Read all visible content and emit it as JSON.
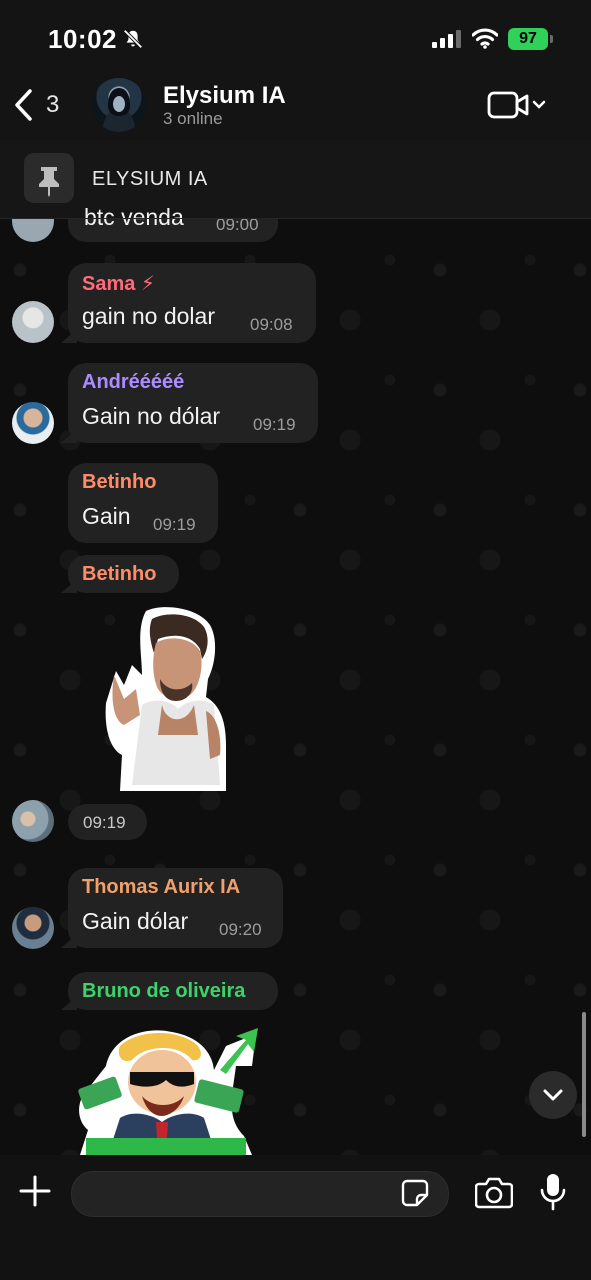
{
  "status_bar": {
    "time": "10:02",
    "battery": "97"
  },
  "header": {
    "back_count": "3",
    "group_name": "Elysium IA",
    "group_status": "3 online"
  },
  "pinned": {
    "text": "ELYSIUM IA"
  },
  "messages": [
    {
      "sender": "",
      "text": "btc venda",
      "time": "09:00"
    },
    {
      "sender": "Sama ⚡",
      "sender_color": "#ff6b7a",
      "text": "gain no dolar",
      "time": "09:08"
    },
    {
      "sender": "Andrééééé",
      "sender_color": "#a98cff",
      "text": "Gain no dólar",
      "time": "09:19"
    },
    {
      "sender": "Betinho",
      "sender_color": "#ff8c69",
      "text": "Gain",
      "time": "09:19"
    },
    {
      "sender": "Betinho",
      "sender_color": "#ff8c69",
      "text": "",
      "time": "09:19"
    },
    {
      "sender": "Thomas Aurix IA",
      "sender_color": "#f0a06a",
      "text": "Gain dólar",
      "time": "09:20"
    },
    {
      "sender": "Bruno de oliveira",
      "sender_color": "#3fd16b",
      "text": "",
      "time": ""
    }
  ],
  "composer": {
    "placeholder": ""
  },
  "colors": {
    "accent_green": "#30d158",
    "bubble": "#222222",
    "background": "#0e0e0e"
  },
  "icons": [
    "back-chevron-icon",
    "video-call-icon",
    "pin-icon",
    "chevron-down-icon",
    "plus-icon",
    "sticker-icon",
    "camera-icon",
    "microphone-icon"
  ]
}
